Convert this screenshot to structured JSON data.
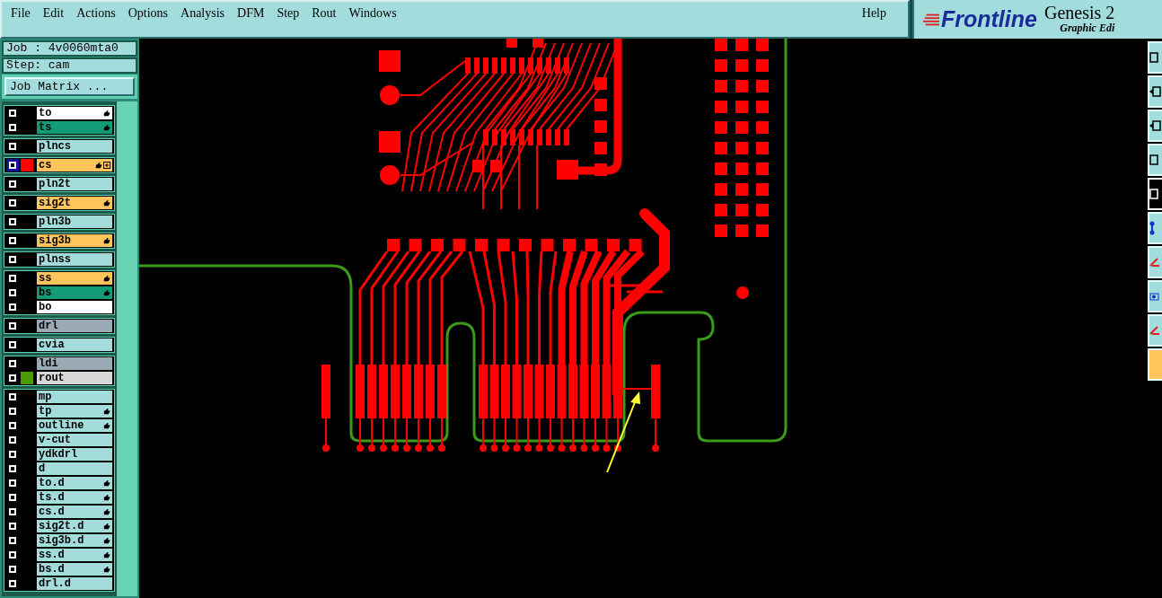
{
  "menu": {
    "items": [
      "File",
      "Edit",
      "Actions",
      "Options",
      "Analysis",
      "DFM",
      "Step",
      "Rout",
      "Windows"
    ],
    "help": "Help"
  },
  "logo": {
    "brand": "Frontline",
    "product": "Genesis 2",
    "subtitle": "Graphic Edi"
  },
  "job": {
    "job": "Job : 4v0060mta0",
    "step": "Step: cam",
    "matrix_button": "Job Matrix ..."
  },
  "layer_groups": [
    [
      {
        "name": "to",
        "color": "#ffffff",
        "hand": true,
        "selected": false
      },
      {
        "name": "ts",
        "color": "#139b78",
        "hand": true,
        "selected": false
      }
    ],
    [
      {
        "name": "plncs",
        "color": "#a4dcdc",
        "hand": false,
        "selected": false
      }
    ],
    [
      {
        "name": "cs",
        "color": "#ffc45c",
        "hand": true,
        "selected": true,
        "swatch": {
          "color": "#ff0000"
        }
      }
    ],
    [
      {
        "name": "pln2t",
        "color": "#a4dcdc",
        "hand": false,
        "selected": false
      }
    ],
    [
      {
        "name": "sig2t",
        "color": "#ffc45c",
        "hand": true,
        "selected": false
      }
    ],
    [
      {
        "name": "pln3b",
        "color": "#a4dcdc",
        "hand": false,
        "selected": false
      }
    ],
    [
      {
        "name": "sig3b",
        "color": "#ffc45c",
        "hand": true,
        "selected": false
      }
    ],
    [
      {
        "name": "plnss",
        "color": "#a4dcdc",
        "hand": false,
        "selected": false
      }
    ],
    [
      {
        "name": "ss",
        "color": "#ffc45c",
        "hand": true,
        "selected": false
      },
      {
        "name": "bs",
        "color": "#139b78",
        "hand": true,
        "selected": false
      },
      {
        "name": "bo",
        "color": "#ffffff",
        "hand": false,
        "selected": false
      }
    ],
    [
      {
        "name": "drl",
        "color": "#99aab4",
        "hand": false,
        "selected": false
      }
    ],
    [
      {
        "name": "cvia",
        "color": "#a4dcdc",
        "hand": false,
        "selected": false
      }
    ],
    [
      {
        "name": "ldi",
        "color": "#99aab4",
        "hand": false,
        "selected": false
      },
      {
        "name": "rout",
        "color": "#d8d8d8",
        "hand": false,
        "selected": false,
        "swatch": {
          "color": "#4c9c00"
        }
      }
    ],
    [
      {
        "name": "mp",
        "color": "#a4dcdc",
        "hand": false,
        "selected": false
      },
      {
        "name": "tp",
        "color": "#a4dcdc",
        "hand": true,
        "selected": false
      },
      {
        "name": "outline",
        "color": "#a4dcdc",
        "hand": true,
        "selected": false
      },
      {
        "name": "v-cut",
        "color": "#a4dcdc",
        "hand": false,
        "selected": false
      },
      {
        "name": "ydkdrl",
        "color": "#a4dcdc",
        "hand": false,
        "selected": false
      },
      {
        "name": "d",
        "color": "#a4dcdc",
        "hand": false,
        "selected": false
      },
      {
        "name": "to.d",
        "color": "#a4dcdc",
        "hand": true,
        "selected": false
      },
      {
        "name": "ts.d",
        "color": "#a4dcdc",
        "hand": true,
        "selected": false
      },
      {
        "name": "cs.d",
        "color": "#a4dcdc",
        "hand": true,
        "selected": false
      },
      {
        "name": "sig2t.d",
        "color": "#a4dcdc",
        "hand": true,
        "selected": false
      },
      {
        "name": "sig3b.d",
        "color": "#a4dcdc",
        "hand": true,
        "selected": false
      },
      {
        "name": "ss.d",
        "color": "#a4dcdc",
        "hand": true,
        "selected": false
      },
      {
        "name": "bs.d",
        "color": "#a4dcdc",
        "hand": true,
        "selected": false
      },
      {
        "name": "drl.d",
        "color": "#a4dcdc",
        "hand": false,
        "selected": false
      }
    ]
  ]
}
